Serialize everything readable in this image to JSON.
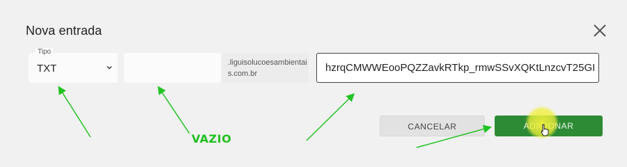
{
  "dialog": {
    "title": "Nova entrada",
    "close_icon": "close-icon"
  },
  "form": {
    "type_label": "Tipo",
    "type_value": "TXT",
    "name_value": "",
    "domain_suffix": ".liguisolucoesambientais.com.br",
    "value": "hzrqCMWWEooPQZZavkRTkp_rmwSSvXQKtLnzcvT25GI"
  },
  "buttons": {
    "cancel": "CANCELAR",
    "add": "ADICIONAR"
  },
  "annotation": {
    "vazio": "VAZIO"
  },
  "colors": {
    "primary": "#2e8b35",
    "arrow": "#22c322",
    "highlight": "#f0f03c"
  }
}
